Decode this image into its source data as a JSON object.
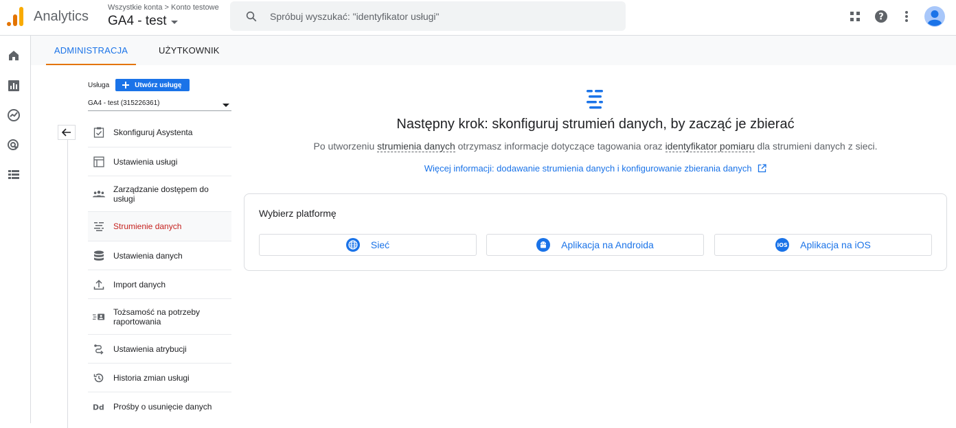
{
  "header": {
    "app_title": "Analytics",
    "breadcrumb": {
      "account": "Wszystkie konta",
      "separator": ">",
      "subaccount": "Konto testowe"
    },
    "property_name": "GA4 - test",
    "search_placeholder": "Spróbuj wyszukać: \"identyfikator usługi\"",
    "icons": [
      "apps-grid-icon",
      "help-icon",
      "more-vert-icon",
      "account-avatar"
    ],
    "brand_colors": {
      "logo_orange": "#f9ab00",
      "logo_dark_orange": "#e37400",
      "accent_blue": "#1a73e8"
    }
  },
  "rail": {
    "icons": [
      "home-icon",
      "reports-icon",
      "explore-icon",
      "advertising-icon",
      "configure-icon"
    ]
  },
  "tabs": [
    {
      "label": "ADMINISTRACJA",
      "active": true
    },
    {
      "label": "UŻYTKOWNIK",
      "active": false
    }
  ],
  "property_panel": {
    "label": "Usługa",
    "create_button": "Utwórz usługę",
    "selected_property": "GA4 - test (315226361)"
  },
  "menu": [
    {
      "label": "Skonfiguruj Asystenta",
      "icon": "checklist-icon",
      "active": false
    },
    {
      "label": "Ustawienia usługi",
      "icon": "property-settings-icon",
      "active": false
    },
    {
      "label": "Zarządzanie dostępem do usługi",
      "icon": "people-icon",
      "active": false
    },
    {
      "label": "Strumienie danych",
      "icon": "data-streams-icon",
      "active": true
    },
    {
      "label": "Ustawienia danych",
      "icon": "database-icon",
      "active": false
    },
    {
      "label": "Import danych",
      "icon": "upload-icon",
      "active": false
    },
    {
      "label": "Tożsamość na potrzeby raportowania",
      "icon": "reporting-identity-icon",
      "active": false
    },
    {
      "label": "Ustawienia atrybucji",
      "icon": "attribution-icon",
      "active": false
    },
    {
      "label": "Historia zmian usługi",
      "icon": "history-icon",
      "active": false
    },
    {
      "label": "Prośby o usunięcie danych",
      "icon": "dd-icon",
      "active": false
    }
  ],
  "main": {
    "title": "Następny krok: skonfiguruj strumień danych, by zacząć je zbierać",
    "subtitle": {
      "part1": "Po utworzeniu",
      "term1": "strumienia danych",
      "part2": "otrzymasz informacje dotyczące tagowania oraz",
      "term2": "identyfikator pomiaru",
      "part3": "dla strumieni danych z sieci."
    },
    "link": "Więcej informacji: dodawanie strumienia danych i konfigurowanie zbierania danych",
    "platform_card": {
      "title": "Wybierz platformę",
      "buttons": [
        {
          "label": "Sieć",
          "icon": "web-globe-icon"
        },
        {
          "label": "Aplikacja na Androida",
          "icon": "android-icon"
        },
        {
          "label": "Aplikacja na iOS",
          "icon": "ios-icon",
          "icon_text": "iOS"
        }
      ]
    }
  }
}
